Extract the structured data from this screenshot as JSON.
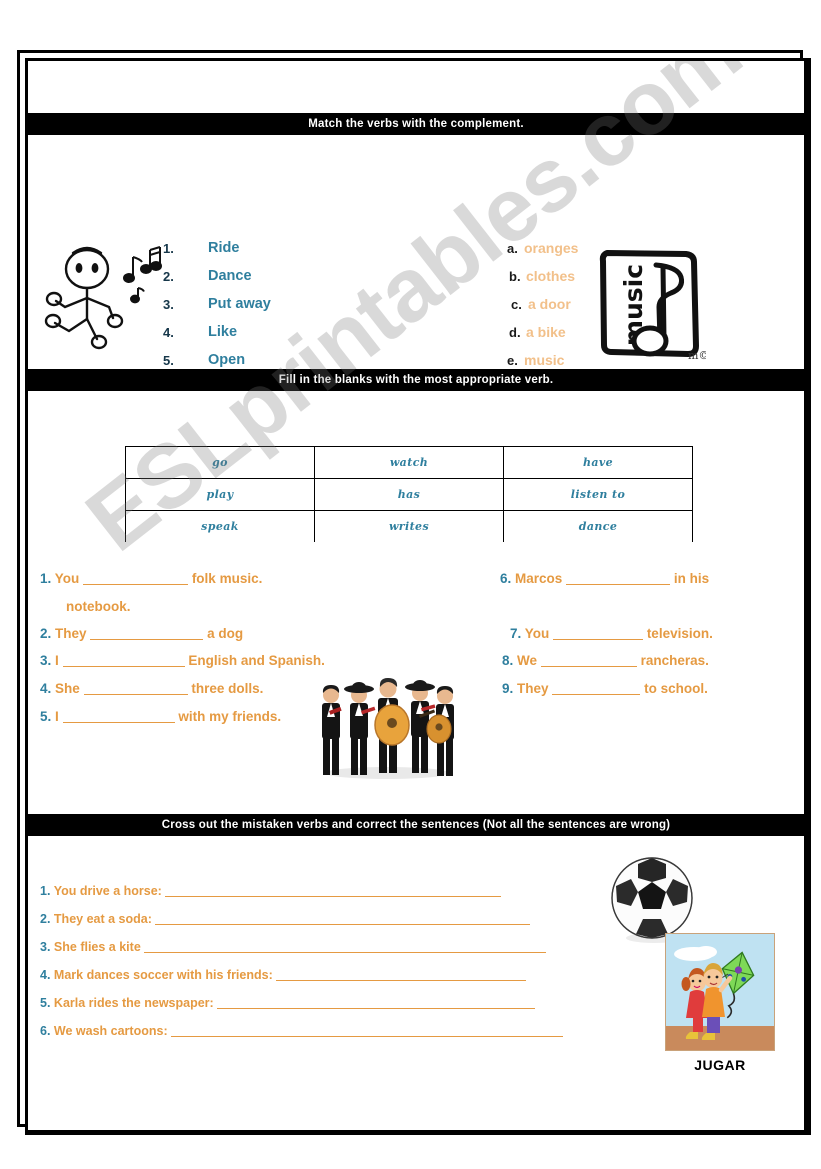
{
  "document": {
    "watermark": "ESLprintables.com"
  },
  "exercise1": {
    "banner": "Match the verbs with the complement.",
    "verbs": [
      {
        "num": "1.",
        "label": "Ride"
      },
      {
        "num": "2.",
        "label": "Dance"
      },
      {
        "num": "3.",
        "label": "Put away"
      },
      {
        "num": "4.",
        "label": "Like"
      },
      {
        "num": "5.",
        "label": "Open"
      }
    ],
    "complements": [
      {
        "letter": "a.",
        "label": "oranges"
      },
      {
        "letter": "b.",
        "label": "clothes"
      },
      {
        "letter": "c.",
        "label": "a door"
      },
      {
        "letter": "d.",
        "label": "a bike"
      },
      {
        "letter": "e.",
        "label": "music"
      }
    ],
    "illustrations": {
      "stick_figure": "dancing-stick-figure-icon",
      "music_card": "music-note-card-icon",
      "music_card_text": "music"
    }
  },
  "exercise2": {
    "banner": "Fill in the blanks with  the most appropriate verb.",
    "word_bank": [
      [
        "go",
        "watch",
        "have"
      ],
      [
        "play",
        "has",
        "listen to"
      ],
      [
        "speak",
        "writes",
        "dance"
      ]
    ],
    "sentences_left": [
      {
        "num": "1.",
        "before": "You",
        "after": "folk music.",
        "continued": "notebook."
      },
      {
        "num": "2.",
        "before": "They",
        "after": "a dog"
      },
      {
        "num": "3.",
        "before": "I",
        "after": "English and Spanish."
      },
      {
        "num": "4.",
        "before": "She",
        "after": "three dolls."
      },
      {
        "num": "5.",
        "before": "I",
        "after": "with my friends."
      }
    ],
    "sentences_right": [
      {
        "num": "6.",
        "before": "Marcos",
        "after": "in his"
      },
      {
        "num": "7.",
        "before": "You",
        "after": "television."
      },
      {
        "num": "8.",
        "before": "We",
        "after": "rancheras."
      },
      {
        "num": "9.",
        "before": "They",
        "after": "to school."
      }
    ],
    "illustration": "mariachi-band-photo"
  },
  "exercise3": {
    "banner": "Cross out the mistaken verbs and correct the sentences (Not all the sentences are wrong)",
    "sentences": [
      {
        "num": "1.",
        "text": "You drive a horse:"
      },
      {
        "num": "2.",
        "text": "They eat a soda:"
      },
      {
        "num": "3.",
        "text": "She flies a kite"
      },
      {
        "num": "4.",
        "text": "Mark dances soccer with his friends:"
      },
      {
        "num": "5.",
        "text": "Karla rides the newspaper:"
      },
      {
        "num": "6.",
        "text": "We wash cartoons:"
      }
    ],
    "illustrations": {
      "soccer_ball": "soccer-ball-icon",
      "kite_picture": "children-flying-kite-picture",
      "kite_caption": "JUGAR"
    }
  },
  "colors": {
    "teal": "#2f7f9e",
    "orange": "#e59a42",
    "peach": "#f2c08a",
    "banner_bg": "#000000"
  }
}
